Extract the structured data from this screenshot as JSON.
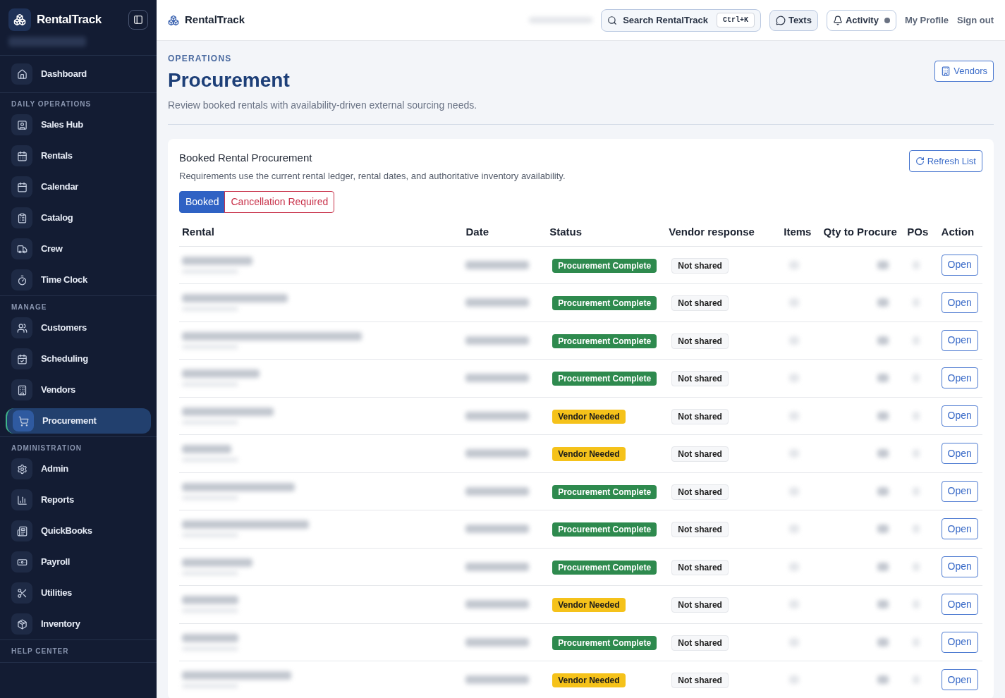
{
  "sidebar": {
    "brand": "RentalTrack",
    "top_item": {
      "label": "Dashboard",
      "selected": false
    },
    "sections": [
      {
        "title": "DAILY OPERATIONS",
        "items": [
          {
            "label": "Sales Hub",
            "selected": false
          },
          {
            "label": "Rentals",
            "selected": false
          },
          {
            "label": "Calendar",
            "selected": false
          },
          {
            "label": "Catalog",
            "selected": false
          },
          {
            "label": "Crew",
            "selected": false
          },
          {
            "label": "Time Clock",
            "selected": false
          }
        ]
      },
      {
        "title": "MANAGE",
        "items": [
          {
            "label": "Customers",
            "selected": false
          },
          {
            "label": "Scheduling",
            "selected": false
          },
          {
            "label": "Vendors",
            "selected": false
          },
          {
            "label": "Procurement",
            "selected": true
          }
        ]
      },
      {
        "title": "ADMINISTRATION",
        "items": [
          {
            "label": "Admin",
            "selected": false
          },
          {
            "label": "Reports",
            "selected": false
          },
          {
            "label": "QuickBooks",
            "selected": false
          },
          {
            "label": "Payroll",
            "selected": false
          },
          {
            "label": "Utilities",
            "selected": false
          },
          {
            "label": "Inventory",
            "selected": false
          }
        ]
      },
      {
        "title": "HELP CENTER"
      }
    ]
  },
  "topbar": {
    "brand": "RentalTrack",
    "search": {
      "label": "Search RentalTrack",
      "shortcut": "Ctrl+K"
    },
    "texts_button": "Texts",
    "activity_button": "Activity",
    "links": [
      "My Profile",
      "Sign out"
    ]
  },
  "header": {
    "eyebrow": "OPERATIONS",
    "title": "Procurement",
    "subtitle": "Review booked rentals with availability-driven external sourcing needs.",
    "vendors_button": "Vendors"
  },
  "card": {
    "title": "Booked Rental Procurement",
    "description": "Requirements use the current rental ledger, rental dates, and authoritative inventory availability.",
    "refresh_button": "Refresh List",
    "filters": [
      {
        "label": "Booked",
        "selected": true,
        "kind": "primary"
      },
      {
        "label": "Cancellation Required",
        "selected": false,
        "kind": "danger"
      }
    ],
    "columns": [
      "Rental",
      "Date",
      "Status",
      "Vendor response",
      "Items",
      "Qty to Procure",
      "POs",
      "Action"
    ],
    "rows": [
      {
        "status": "Procurement Complete",
        "kind": "complete",
        "vendor_response": "Not shared",
        "action": "Open"
      },
      {
        "status": "Procurement Complete",
        "kind": "complete",
        "vendor_response": "Not shared",
        "action": "Open"
      },
      {
        "status": "Procurement Complete",
        "kind": "complete",
        "vendor_response": "Not shared",
        "action": "Open"
      },
      {
        "status": "Procurement Complete",
        "kind": "complete",
        "vendor_response": "Not shared",
        "action": "Open"
      },
      {
        "status": "Vendor Needed",
        "kind": "needed",
        "vendor_response": "Not shared",
        "action": "Open"
      },
      {
        "status": "Vendor Needed",
        "kind": "needed",
        "vendor_response": "Not shared",
        "action": "Open"
      },
      {
        "status": "Procurement Complete",
        "kind": "complete",
        "vendor_response": "Not shared",
        "action": "Open"
      },
      {
        "status": "Procurement Complete",
        "kind": "complete",
        "vendor_response": "Not shared",
        "action": "Open"
      },
      {
        "status": "Procurement Complete",
        "kind": "complete",
        "vendor_response": "Not shared",
        "action": "Open"
      },
      {
        "status": "Vendor Needed",
        "kind": "needed",
        "vendor_response": "Not shared",
        "action": "Open"
      },
      {
        "status": "Procurement Complete",
        "kind": "complete",
        "vendor_response": "Not shared",
        "action": "Open"
      },
      {
        "status": "Vendor Needed",
        "kind": "needed",
        "vendor_response": "Not shared",
        "action": "Open"
      }
    ]
  }
}
